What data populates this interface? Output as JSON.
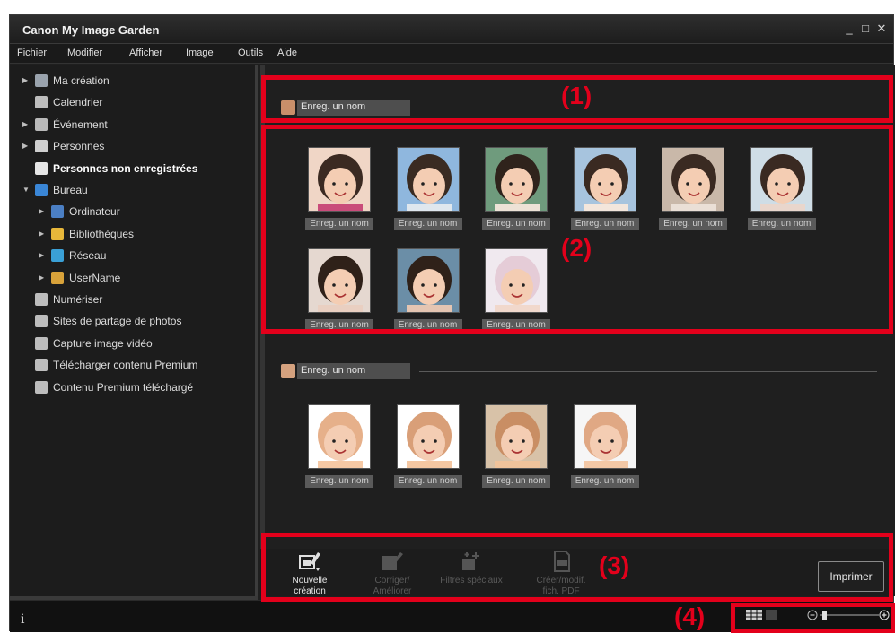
{
  "window": {
    "title": "Canon My Image Garden"
  },
  "window_controls": {
    "minimize": "_",
    "maximize": "□",
    "close": "✕"
  },
  "menu": [
    "Fichier",
    "Modifier",
    "Afficher",
    "Image",
    "Outils",
    "Aide"
  ],
  "sidebar": {
    "items": [
      {
        "label": "Ma création",
        "icon": "my-creation-icon",
        "expand": true
      },
      {
        "label": "Calendrier",
        "icon": "calendar-icon",
        "expand": false
      },
      {
        "label": "Événement",
        "icon": "event-icon",
        "expand": true
      },
      {
        "label": "Personnes",
        "icon": "people-icon",
        "expand": true
      },
      {
        "label": "Personnes non enregistrées",
        "icon": "unregistered-person-icon",
        "expand": false,
        "selected": true
      },
      {
        "label": "Bureau",
        "icon": "desktop-icon",
        "expand": true,
        "expanded": true
      },
      {
        "label": "Ordinateur",
        "icon": "computer-icon",
        "expand": true,
        "indent": 1
      },
      {
        "label": "Bibliothèques",
        "icon": "libraries-icon",
        "expand": true,
        "indent": 1
      },
      {
        "label": "Réseau",
        "icon": "network-icon",
        "expand": true,
        "indent": 1
      },
      {
        "label": "UserName",
        "icon": "user-folder-icon",
        "expand": true,
        "indent": 1
      },
      {
        "label": "Numériser",
        "icon": "scan-icon",
        "expand": false
      },
      {
        "label": "Sites de partage de photos",
        "icon": "photo-sharing-icon",
        "expand": false
      },
      {
        "label": "Capture image vidéo",
        "icon": "video-capture-icon",
        "expand": false
      },
      {
        "label": "Télécharger contenu Premium",
        "icon": "download-premium-icon",
        "expand": false
      },
      {
        "label": "Contenu Premium téléchargé",
        "icon": "folder-icon",
        "expand": false
      }
    ]
  },
  "groups": [
    {
      "name": "Enreg. un nom",
      "thumbs": [
        {
          "caption": "Enreg. un nom"
        },
        {
          "caption": "Enreg. un nom"
        },
        {
          "caption": "Enreg. un nom"
        },
        {
          "caption": "Enreg. un nom"
        },
        {
          "caption": "Enreg. un nom"
        },
        {
          "caption": "Enreg. un nom"
        },
        {
          "caption": "Enreg. un nom"
        },
        {
          "caption": "Enreg. un nom"
        },
        {
          "caption": "Enreg. un nom"
        }
      ]
    },
    {
      "name": "Enreg. un nom",
      "thumbs": [
        {
          "caption": "Enreg. un nom"
        },
        {
          "caption": "Enreg. un nom"
        },
        {
          "caption": "Enreg. un nom"
        },
        {
          "caption": "Enreg. un nom"
        }
      ]
    }
  ],
  "callouts": [
    "(1)",
    "(2)",
    "(3)",
    "(4)"
  ],
  "toolbar": {
    "buttons": [
      {
        "label": "Nouvelle création",
        "icon": "new-creation-icon",
        "enabled": true
      },
      {
        "label": "Corriger/ Améliorer",
        "icon": "correct-enhance-icon",
        "enabled": false
      },
      {
        "label": "Filtres spéciaux",
        "icon": "special-filters-icon",
        "enabled": false
      },
      {
        "label": "Créer/modif. fich. PDF",
        "icon": "pdf-icon",
        "enabled": false
      }
    ],
    "print": "Imprimer"
  },
  "status": {
    "info_icon": "i"
  },
  "colors": {
    "highlight": "#e3001b",
    "background": "#1f1f1f"
  }
}
